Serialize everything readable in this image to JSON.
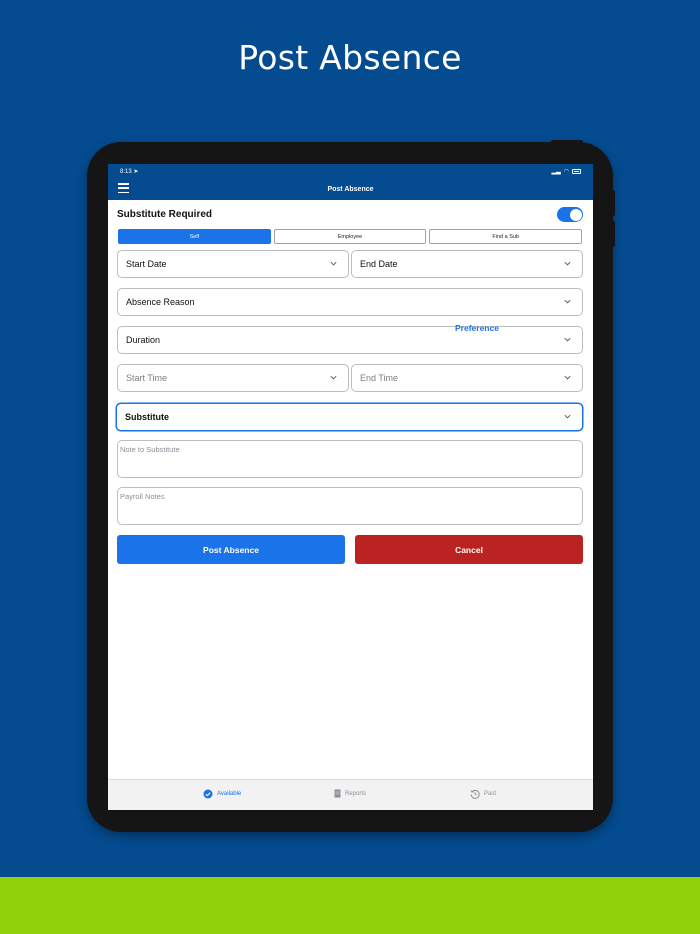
{
  "hero": {
    "title": "Post Absence"
  },
  "status_bar": {
    "time": "8:13"
  },
  "navbar": {
    "title": "Post Absence"
  },
  "substitute_toggle": {
    "label": "Substitute Required",
    "on": true
  },
  "segments": [
    {
      "label": "Self",
      "active": true
    },
    {
      "label": "Employee",
      "active": false
    },
    {
      "label": "Find a Sub",
      "active": false
    }
  ],
  "form": {
    "start_date": "Start Date",
    "end_date": "End Date",
    "absence_reason": "Absence Reason",
    "duration": "Duration",
    "preference": "Preference",
    "start_time_placeholder": "Start Time",
    "end_time_placeholder": "End Time",
    "substitute": "Substitute",
    "note_placeholder": "Note to Substitute",
    "payroll_placeholder": "Payroll Notes"
  },
  "actions": {
    "post": "Post Absence",
    "cancel": "Cancel"
  },
  "tabbar": [
    {
      "label": "Available",
      "icon": "check-circle-icon",
      "active": true
    },
    {
      "label": "Reports",
      "icon": "document-icon",
      "active": false
    },
    {
      "label": "Past",
      "icon": "history-icon",
      "active": false
    }
  ],
  "colors": {
    "brand_blue": "#044b8f",
    "accent_blue": "#1a73e8",
    "cancel_red": "#bb2222",
    "band_green": "#8fd10a"
  }
}
